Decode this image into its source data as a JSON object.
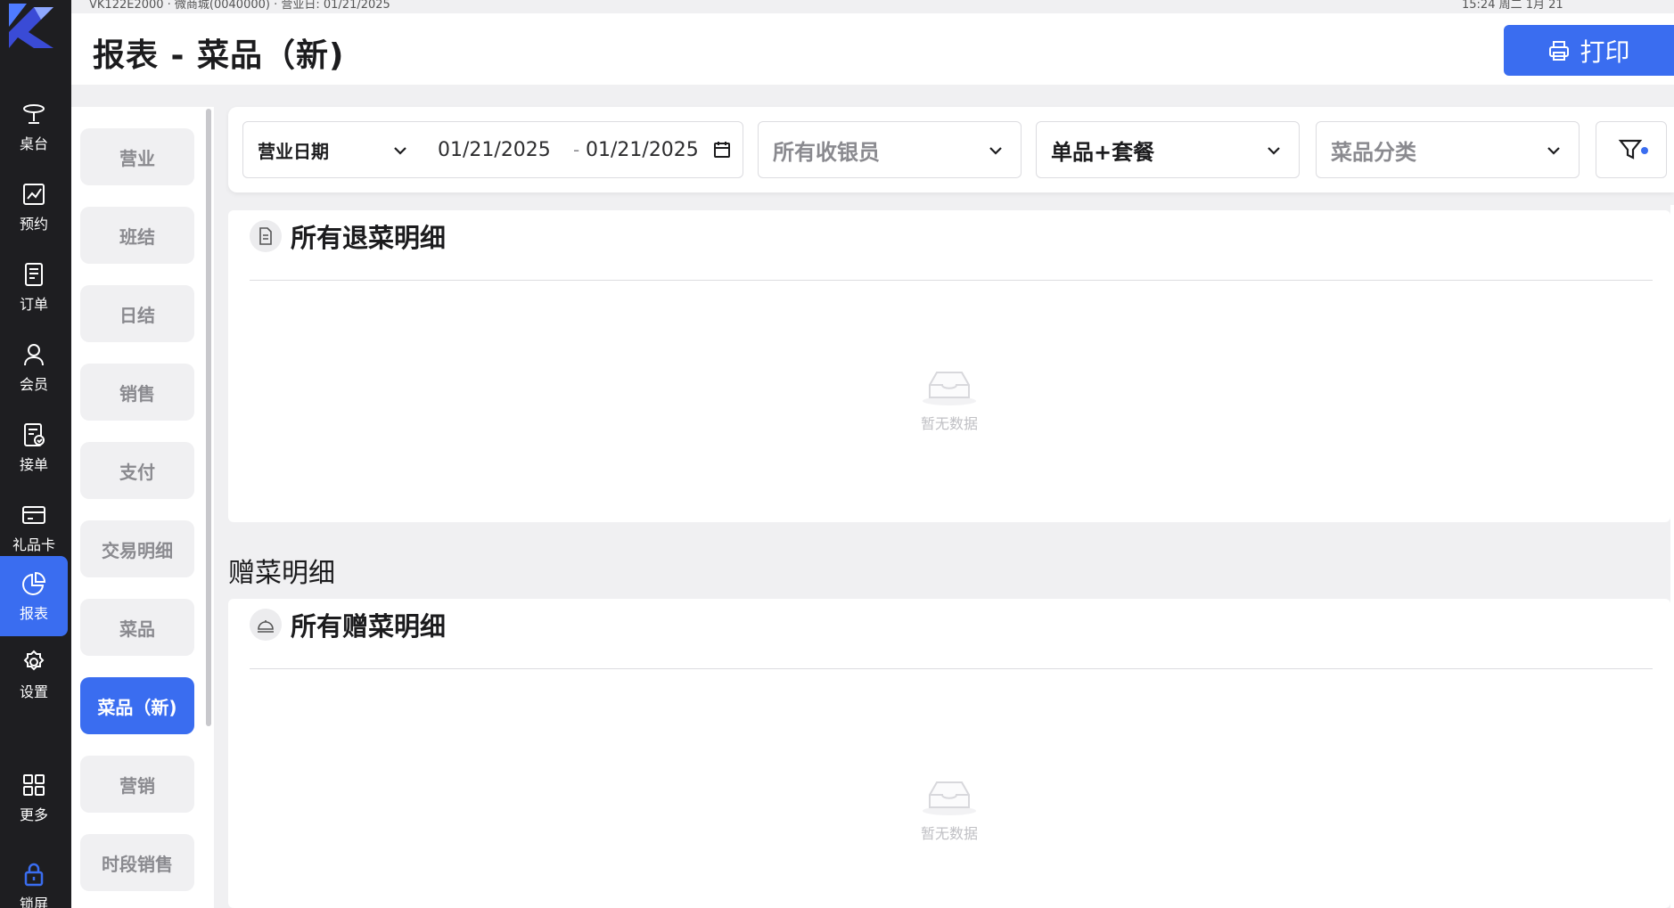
{
  "header": {
    "page_title": "报表 - 菜品（新)",
    "print_label": "打印",
    "top_strip_left": "VK122E2000 · 微商城(0040000) · 营业日: 01/21/2025",
    "top_strip_right": "15:24 周二 1月 21"
  },
  "nav": {
    "items": [
      {
        "label": "桌台",
        "icon": "table-icon"
      },
      {
        "label": "预约",
        "icon": "reservation-icon"
      },
      {
        "label": "订单",
        "icon": "order-icon"
      },
      {
        "label": "会员",
        "icon": "member-icon"
      },
      {
        "label": "接单",
        "icon": "accept-order-icon"
      },
      {
        "label": "礼品卡",
        "icon": "gift-card-icon"
      },
      {
        "label": "报表",
        "icon": "report-icon",
        "active": true
      },
      {
        "label": "设置",
        "icon": "settings-icon"
      },
      {
        "label": "更多",
        "icon": "more-grid-icon"
      },
      {
        "label": "锁屏",
        "icon": "lock-icon"
      }
    ]
  },
  "report_nav": {
    "items": [
      "营业",
      "班结",
      "日结",
      "销售",
      "支付",
      "交易明细",
      "菜品",
      "菜品（新)",
      "营销",
      "时段销售"
    ],
    "active": "菜品（新)"
  },
  "filters": {
    "date_type": "营业日期",
    "date_start": "01/21/2025",
    "date_sep": "-",
    "date_end": "01/21/2025",
    "cashier": "所有收银员",
    "item_type": "单品+套餐",
    "category": "菜品分类"
  },
  "returns_panel": {
    "title": "所有退菜明细",
    "icon": "document-icon",
    "empty_text": "暂无数据"
  },
  "gift_section_title": "赠菜明细",
  "gift_panel": {
    "title": "所有赠菜明细",
    "icon": "service-bell-icon",
    "empty_text": "暂无数据"
  },
  "colors": {
    "accent": "#3a6df0",
    "nav_bg": "#1e1e21",
    "page_bg": "#f0f0f2"
  }
}
